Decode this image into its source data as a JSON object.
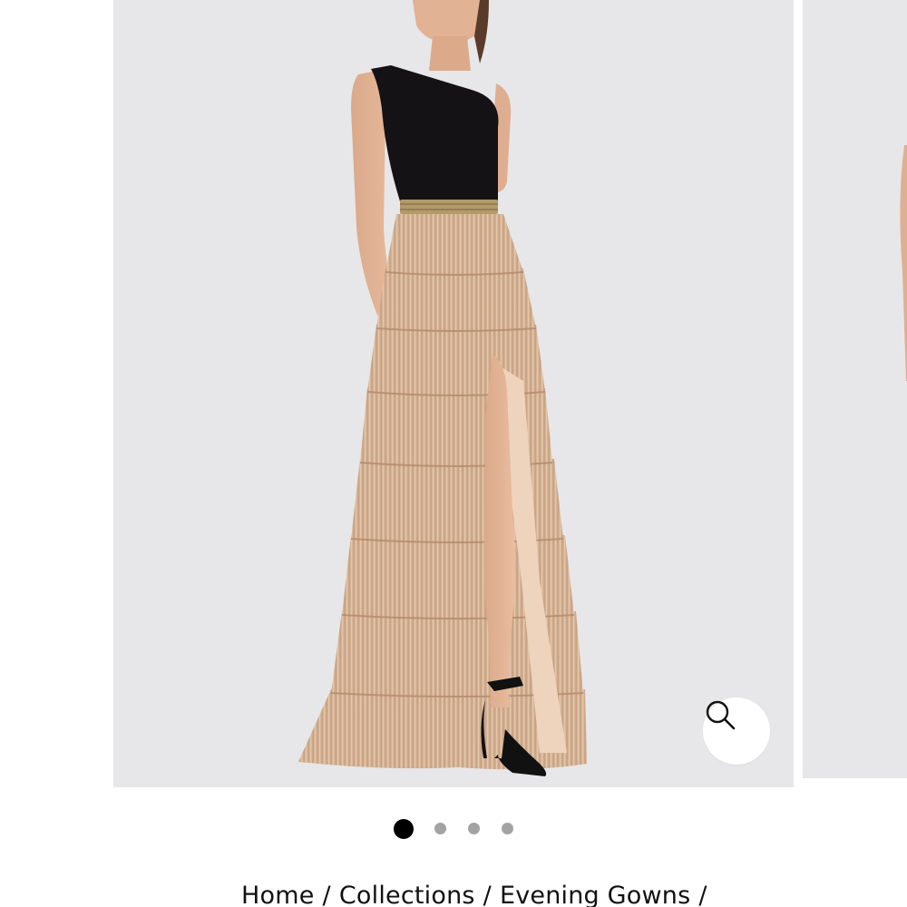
{
  "gallery": {
    "slide_count": 4,
    "active_slide": 1,
    "dot_labels": [
      "Slide 1",
      "Slide 2",
      "Slide 3",
      "Slide 4"
    ],
    "zoom_icon": "magnifier-icon",
    "colors": {
      "slide_background": "#e7e7e9",
      "dress_bodice": "#141214",
      "dress_skirt": "#d9b89a",
      "active_dot": "#000000",
      "inactive_dot": "#a3a3a3"
    }
  },
  "breadcrumb": {
    "items": [
      {
        "label": "Home"
      },
      {
        "label": "Collections"
      },
      {
        "label": "Evening Gowns"
      }
    ],
    "separator": "/"
  }
}
